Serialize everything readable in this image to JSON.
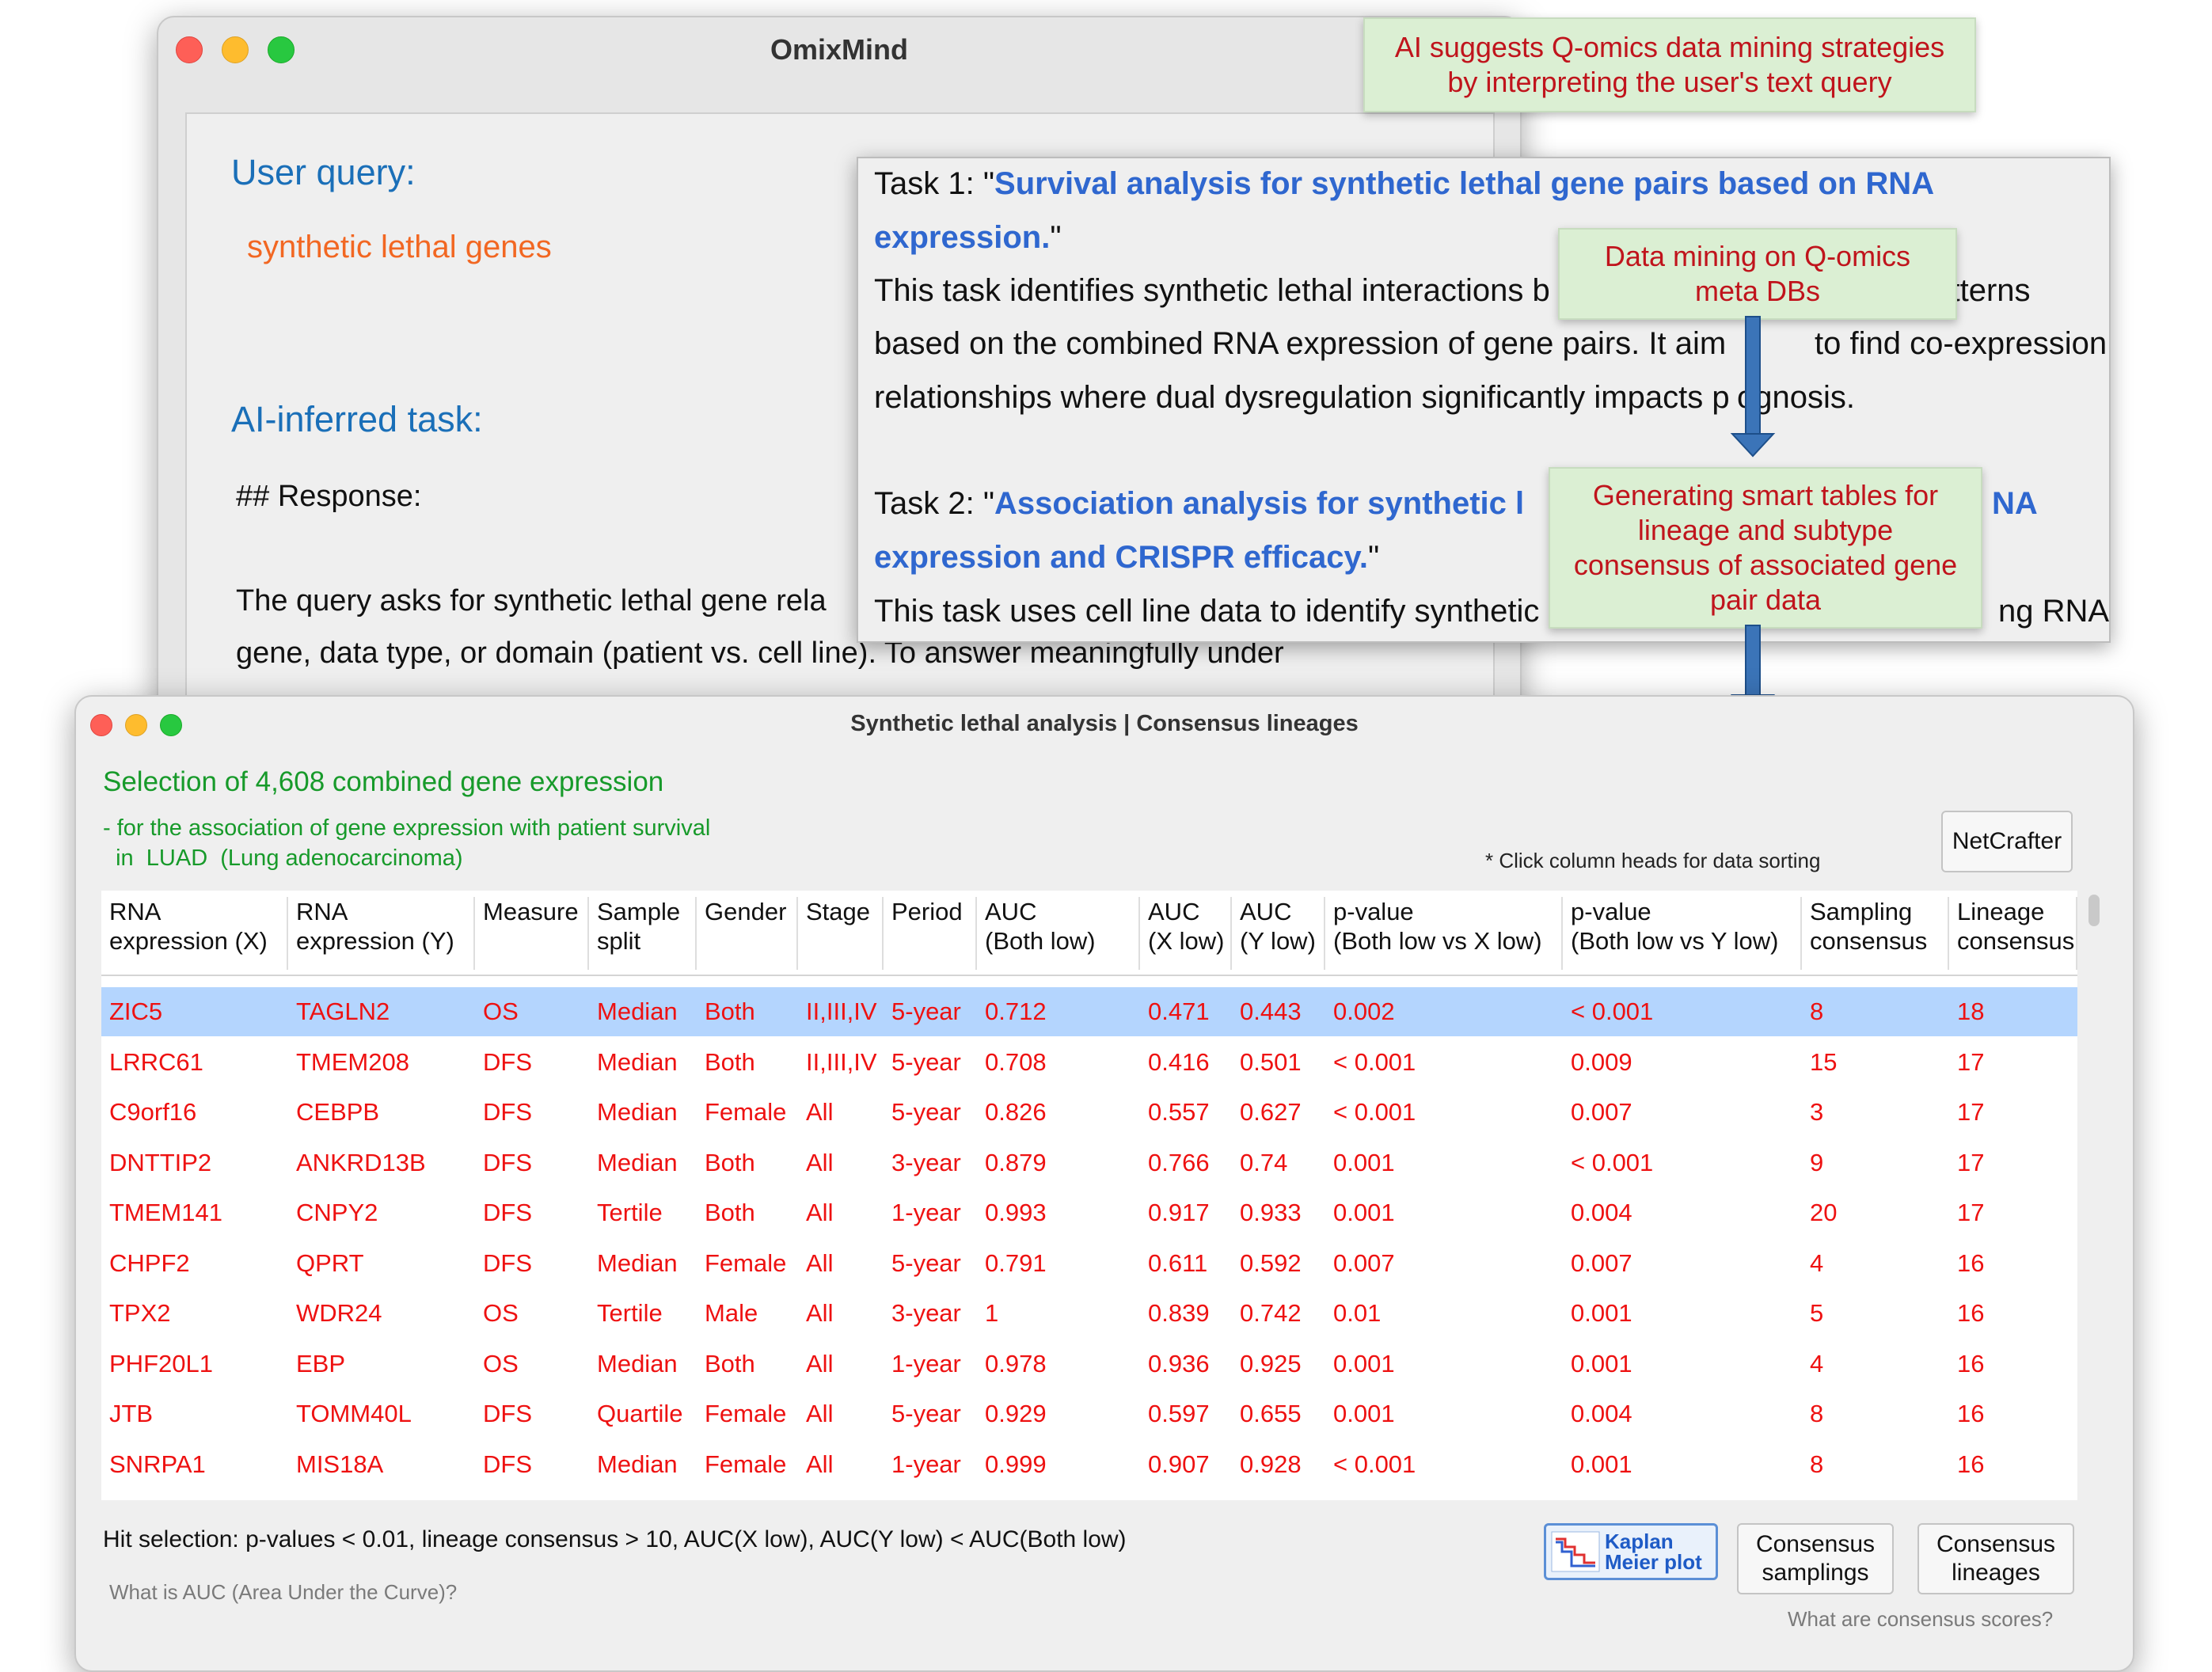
{
  "window_main": {
    "title": "OmixMind",
    "user_query_label": "User query:",
    "user_query_value": "synthetic lethal genes",
    "ai_task_label": "AI-inferred task:",
    "response_heading": "## Response:",
    "response_line1": "The query asks for synthetic lethal gene rela",
    "response_line2": "gene, data type, or domain (patient vs. cell line). To answer meaningfully under"
  },
  "task_popup": {
    "task1_prefix": "Task 1: \"",
    "task1_title_a": "Survival analysis for synthetic lethal gene pairs based on RNA",
    "task1_title_b": "expression.",
    "task1_suffix": "\"",
    "task1_desc1": "This task identifies synthetic lethal interactions b",
    "task1_desc1_end": "l patterns",
    "task1_desc2a": "based on the combined RNA expression of gene pairs. It aim",
    "task1_desc2b": "to find co-expression",
    "task1_desc3a": "relationships where dual dysregulation significantly impacts p",
    "task1_desc3b": "ognosis.",
    "task2_prefix": "Task 2: \"",
    "task2_title_a": "Association analysis for synthetic l",
    "task2_title_a_end": "NA",
    "task2_title_b": "expression and CRISPR efficacy.",
    "task2_suffix": "\"",
    "task2_desc1": "This task uses cell line data to identify synthetic",
    "task2_desc1_end": "ng RNA"
  },
  "annotations": {
    "ann1_line1": "AI suggests Q-omics data mining strategies",
    "ann1_line2": "by interpreting the user's text query",
    "ann2_line1": "Data mining on Q-omics",
    "ann2_line2": "meta DBs",
    "ann3_line1": "Generating smart tables for",
    "ann3_line2": "lineage and subtype",
    "ann3_line3": "consensus of associated gene",
    "ann3_line4": "pair data"
  },
  "window_table": {
    "title": "Synthetic lethal analysis | Consensus lineages",
    "selection_title": "Selection of 4,608 combined gene expression",
    "subtitle1": "- for the association of gene expression with patient survival",
    "subtitle2": "  in  LUAD  (Lung adenocarcinoma)",
    "sort_hint": "* Click column heads for data sorting",
    "netcrafter_label": "NetCrafter",
    "hit_selection": "Hit selection: p-values < 0.01, lineage consensus > 10, AUC(X low), AUC(Y low) < AUC(Both low)",
    "auc_help": "What is AUC (Area Under the Curve)?",
    "consensus_help": "What are consensus scores?",
    "km_label_line1": "Kaplan",
    "km_label_line2": "Meier plot",
    "btn_samplings_line1": "Consensus",
    "btn_samplings_line2": "samplings",
    "btn_lineages_line1": "Consensus",
    "btn_lineages_line2": "lineages",
    "columns": [
      {
        "l1": "RNA",
        "l2": "expression (X)"
      },
      {
        "l1": "RNA",
        "l2": "expression (Y)"
      },
      {
        "l1": "Measure",
        "l2": ""
      },
      {
        "l1": "Sample",
        "l2": "split"
      },
      {
        "l1": "Gender",
        "l2": ""
      },
      {
        "l1": "Stage",
        "l2": ""
      },
      {
        "l1": "Period",
        "l2": ""
      },
      {
        "l1": "AUC",
        "l2": "(Both low)"
      },
      {
        "l1": "AUC",
        "l2": "(X low)"
      },
      {
        "l1": "AUC",
        "l2": "(Y low)"
      },
      {
        "l1": "p-value",
        "l2": "(Both low vs X low)"
      },
      {
        "l1": "p-value",
        "l2": "(Both low vs Y low)"
      },
      {
        "l1": "Sampling",
        "l2": "consensus"
      },
      {
        "l1": "Lineage",
        "l2": "consensus"
      }
    ],
    "rows": [
      [
        "ZIC5",
        "TAGLN2",
        "OS",
        "Median",
        "Both",
        "II,III,IV",
        "5-year",
        "0.712",
        "0.471",
        "0.443",
        "0.002",
        "< 0.001",
        "8",
        "18"
      ],
      [
        "LRRC61",
        "TMEM208",
        "DFS",
        "Median",
        "Both",
        "II,III,IV",
        "5-year",
        "0.708",
        "0.416",
        "0.501",
        "< 0.001",
        "0.009",
        "15",
        "17"
      ],
      [
        "C9orf16",
        "CEBPB",
        "DFS",
        "Median",
        "Female",
        "All",
        "5-year",
        "0.826",
        "0.557",
        "0.627",
        "< 0.001",
        "0.007",
        "3",
        "17"
      ],
      [
        "DNTTIP2",
        "ANKRD13B",
        "DFS",
        "Median",
        "Both",
        "All",
        "3-year",
        "0.879",
        "0.766",
        "0.74",
        "0.001",
        "< 0.001",
        "9",
        "17"
      ],
      [
        "TMEM141",
        "CNPY2",
        "DFS",
        "Tertile",
        "Both",
        "All",
        "1-year",
        "0.993",
        "0.917",
        "0.933",
        "0.001",
        "0.004",
        "20",
        "17"
      ],
      [
        "CHPF2",
        "QPRT",
        "DFS",
        "Median",
        "Female",
        "All",
        "5-year",
        "0.791",
        "0.611",
        "0.592",
        "0.007",
        "0.007",
        "4",
        "16"
      ],
      [
        "TPX2",
        "WDR24",
        "OS",
        "Tertile",
        "Male",
        "All",
        "3-year",
        "1",
        "0.839",
        "0.742",
        "0.01",
        "0.001",
        "5",
        "16"
      ],
      [
        "PHF20L1",
        "EBP",
        "OS",
        "Median",
        "Both",
        "All",
        "1-year",
        "0.978",
        "0.936",
        "0.925",
        "0.001",
        "0.001",
        "4",
        "16"
      ],
      [
        "JTB",
        "TOMM40L",
        "DFS",
        "Quartile",
        "Female",
        "All",
        "5-year",
        "0.929",
        "0.597",
        "0.655",
        "0.001",
        "0.004",
        "8",
        "16"
      ],
      [
        "SNRPA1",
        "MIS18A",
        "DFS",
        "Median",
        "Female",
        "All",
        "1-year",
        "0.999",
        "0.907",
        "0.928",
        "< 0.001",
        "0.001",
        "8",
        "16"
      ]
    ],
    "selected_row": 0
  }
}
